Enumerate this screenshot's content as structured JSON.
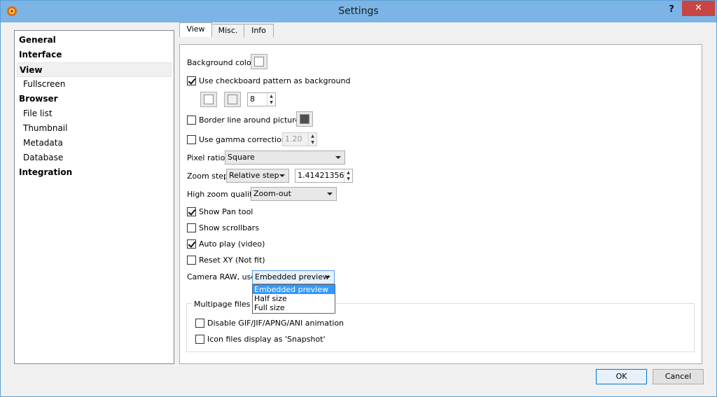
{
  "window": {
    "title": "Settings",
    "help_glyph": "?",
    "close_glyph": "✕"
  },
  "tree": {
    "items": [
      {
        "label": "General"
      },
      {
        "label": "Interface"
      },
      {
        "label": "View"
      },
      {
        "label": "Fullscreen"
      },
      {
        "label": "Browser"
      },
      {
        "label": "File list"
      },
      {
        "label": "Thumbnail"
      },
      {
        "label": "Metadata"
      },
      {
        "label": "Database"
      },
      {
        "label": "Integration"
      }
    ]
  },
  "tabs": [
    {
      "label": "View"
    },
    {
      "label": "Misc."
    },
    {
      "label": "Info"
    }
  ],
  "view": {
    "background_color_label": "Background color",
    "checkboard_label": "Use checkboard pattern as background",
    "checkboard_size": "8",
    "border_line_label": "Border line around picture",
    "gamma_label": "Use gamma correction",
    "gamma_value": "1.20",
    "pixel_ratio_label": "Pixel ratio",
    "pixel_ratio_value": "Square",
    "zoom_step_label": "Zoom step",
    "zoom_step_value": "Relative step",
    "zoom_step_number": "1.41421356",
    "high_zoom_label": "High zoom quality",
    "high_zoom_value": "Zoom-out",
    "show_pan_label": "Show Pan tool",
    "show_scrollbars_label": "Show scrollbars",
    "auto_play_label": "Auto play (video)",
    "reset_xy_label": "Reset XY (Not fit)",
    "camera_raw_label": "Camera RAW, use",
    "camera_raw_value": "Embedded preview",
    "camera_raw_options": [
      "Embedded preview",
      "Half size",
      "Full size"
    ],
    "multipage_title": "Multipage files",
    "disable_anim_label": "Disable GIF/JIF/APNG/ANI animation",
    "icon_snapshot_label": "Icon files display as 'Snapshot'"
  },
  "checkstates": {
    "checkboard": true,
    "border_line": false,
    "gamma": false,
    "show_pan": true,
    "show_scrollbars": false,
    "auto_play": true,
    "reset_xy": false,
    "disable_anim": false,
    "icon_snapshot": false
  },
  "colors": {
    "border_swatch": "#505050",
    "title_bar": "#7cb4e6",
    "selection": "#3399ff",
    "close_button": "#c74543"
  },
  "buttons": {
    "ok": "OK",
    "cancel": "Cancel"
  }
}
